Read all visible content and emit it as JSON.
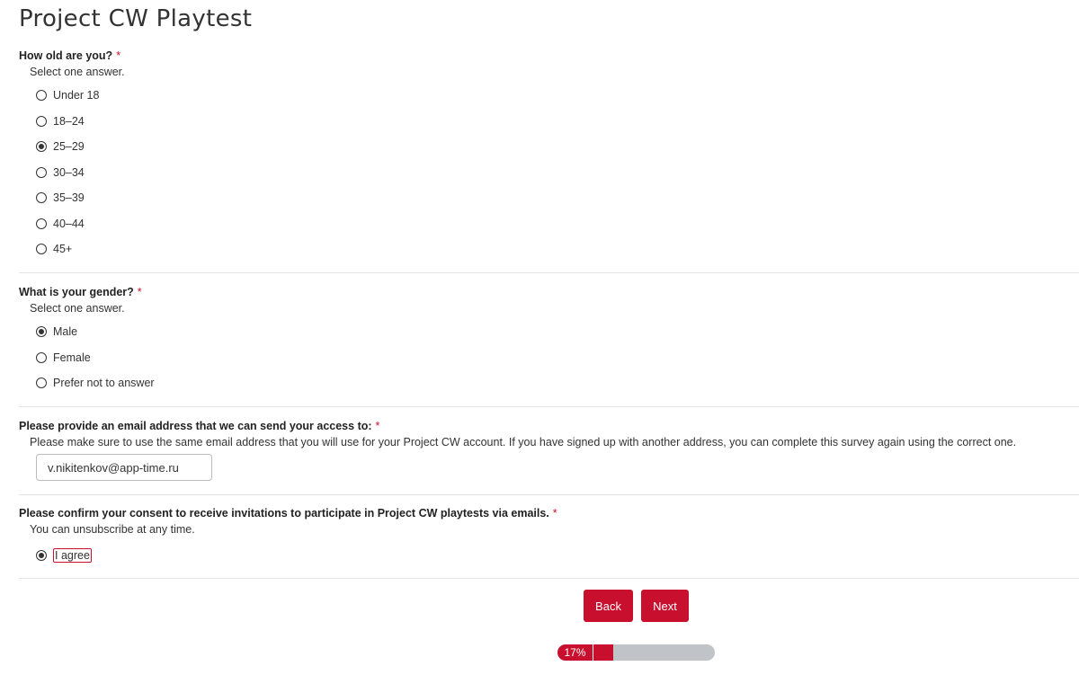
{
  "title": "Project CW Playtest",
  "required_mark": "*",
  "q1": {
    "label": "How old are you?",
    "hint": "Select one answer.",
    "options": [
      "Under 18",
      "18–24",
      "25–29",
      "30–34",
      "35–39",
      "40–44",
      "45+"
    ],
    "selected": "25–29"
  },
  "q2": {
    "label": "What is your gender?",
    "hint": "Select one answer.",
    "options": [
      "Male",
      "Female",
      "Prefer not to answer"
    ],
    "selected": "Male"
  },
  "q3": {
    "label": "Please provide an email address that we can send your access to:",
    "hint": "Please make sure to use the same email address that you will use for your Project CW account. If you have signed up with another address, you can complete this survey again using the correct one.",
    "value": "v.nikitenkov@app-time.ru"
  },
  "q4": {
    "label": "Please confirm your consent to receive invitations to participate in Project CW playtests via emails.",
    "hint": "You can unsubscribe at any time.",
    "option": "I agree",
    "selected": true
  },
  "buttons": {
    "back": "Back",
    "next": "Next"
  },
  "progress": {
    "label": "17%",
    "percent": 17
  },
  "colors": {
    "accent": "#c8102e",
    "track": "#c0c4c8"
  }
}
